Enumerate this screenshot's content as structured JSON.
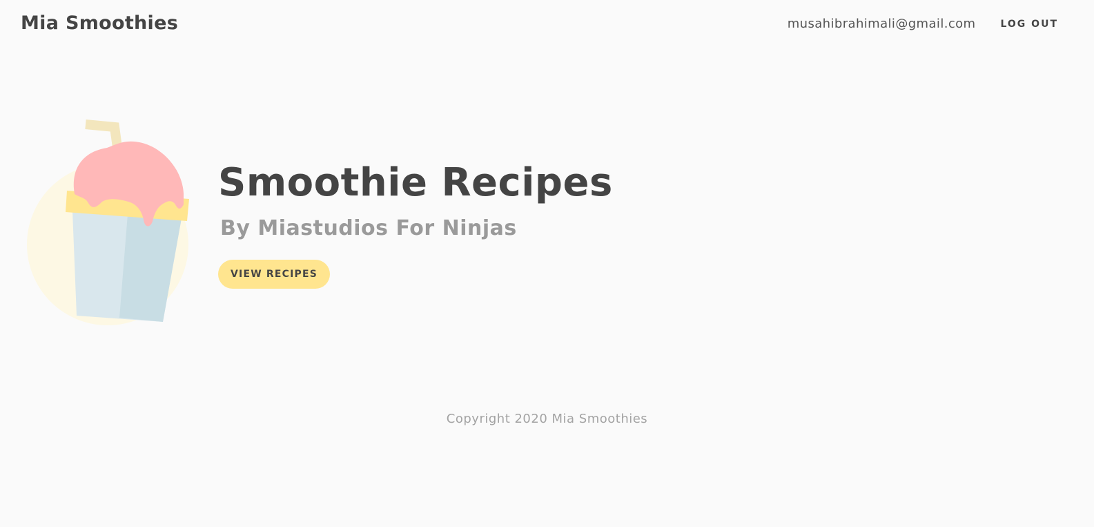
{
  "navbar": {
    "brand": "Mia Smoothies",
    "user_email": "musahibrahimali@gmail.com",
    "logout_label": "LOG OUT"
  },
  "hero": {
    "title": "Smoothie Recipes",
    "subtitle": "By Miastudios For Ninjas",
    "button_label": "VIEW RECIPES",
    "illustration_icon": "smoothie-cup-icon"
  },
  "footer": {
    "copyright": "Copyright 2020 Mia Smoothies"
  },
  "colors": {
    "background": "#fafafa",
    "text_dark": "#444444",
    "text_muted": "#9a9a9a",
    "accent_yellow": "#ffe58f",
    "smoothie_pink": "#ffb8b8",
    "cup_blue": "#d8e8ee"
  }
}
